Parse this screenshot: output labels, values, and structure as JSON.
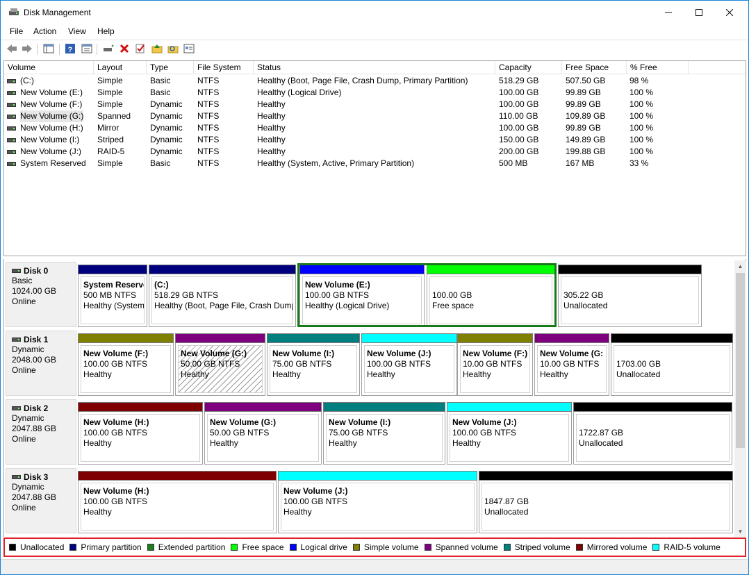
{
  "window": {
    "title": "Disk Management"
  },
  "menu": [
    "File",
    "Action",
    "View",
    "Help"
  ],
  "list": {
    "columns": [
      "Volume",
      "Layout",
      "Type",
      "File System",
      "Status",
      "Capacity",
      "Free Space",
      "% Free"
    ],
    "rows": [
      {
        "volume": "(C:)",
        "layout": "Simple",
        "type": "Basic",
        "fs": "NTFS",
        "status": "Healthy (Boot, Page File, Crash Dump, Primary Partition)",
        "capacity": "518.29 GB",
        "free": "507.50 GB",
        "pct": "98 %"
      },
      {
        "volume": "New Volume (E:)",
        "layout": "Simple",
        "type": "Basic",
        "fs": "NTFS",
        "status": "Healthy (Logical Drive)",
        "capacity": "100.00 GB",
        "free": "99.89 GB",
        "pct": "100 %"
      },
      {
        "volume": "New Volume (F:)",
        "layout": "Simple",
        "type": "Dynamic",
        "fs": "NTFS",
        "status": "Healthy",
        "capacity": "100.00 GB",
        "free": "99.89 GB",
        "pct": "100 %"
      },
      {
        "volume": "New Volume (G:)",
        "layout": "Spanned",
        "type": "Dynamic",
        "fs": "NTFS",
        "status": "Healthy",
        "capacity": "110.00 GB",
        "free": "109.89 GB",
        "pct": "100 %"
      },
      {
        "volume": "New Volume (H:)",
        "layout": "Mirror",
        "type": "Dynamic",
        "fs": "NTFS",
        "status": "Healthy",
        "capacity": "100.00 GB",
        "free": "99.89 GB",
        "pct": "100 %"
      },
      {
        "volume": "New Volume (I:)",
        "layout": "Striped",
        "type": "Dynamic",
        "fs": "NTFS",
        "status": "Healthy",
        "capacity": "150.00 GB",
        "free": "149.89 GB",
        "pct": "100 %"
      },
      {
        "volume": "New Volume (J:)",
        "layout": "RAID-5",
        "type": "Dynamic",
        "fs": "NTFS",
        "status": "Healthy",
        "capacity": "200.00 GB",
        "free": "199.88 GB",
        "pct": "100 %"
      },
      {
        "volume": "System Reserved",
        "layout": "Simple",
        "type": "Basic",
        "fs": "NTFS",
        "status": "Healthy (System, Active, Primary Partition)",
        "capacity": "500 MB",
        "free": "167 MB",
        "pct": "33 %"
      }
    ]
  },
  "colors": {
    "unallocated": "#000000",
    "primary": "#00007f",
    "extended": "#1f7f1f",
    "free": "#00ff00",
    "logical": "#0000ff",
    "simple": "#7f7f00",
    "spanned": "#7f007f",
    "striped": "#007f7f",
    "mirrored": "#7f0000",
    "raid5": "#00ffff"
  },
  "disks": [
    {
      "name": "Disk 0",
      "kind": "Basic",
      "size": "1024.00 GB",
      "state": "Online",
      "partitions": [
        {
          "title": "System Reserve",
          "size": "500 MB NTFS",
          "status": "Healthy (System",
          "color": "#00007f"
        },
        {
          "title": "(C:)",
          "size": "518.29 GB NTFS",
          "status": "Healthy (Boot, Page File, Crash Dump",
          "color": "#00007f"
        },
        {
          "title": "New Volume  (E:)",
          "size": "100.00 GB NTFS",
          "status": "Healthy (Logical Drive)",
          "color": "#0000ff"
        },
        {
          "title": "",
          "size": "100.00 GB",
          "status": "Free space",
          "color": "#00ff00"
        },
        {
          "title": "",
          "size": "305.22 GB",
          "status": "Unallocated",
          "color": "#000000"
        }
      ]
    },
    {
      "name": "Disk 1",
      "kind": "Dynamic",
      "size": "2048.00 GB",
      "state": "Online",
      "partitions": [
        {
          "title": "New Volume  (F:)",
          "size": "100.00 GB NTFS",
          "status": "Healthy",
          "color": "#7f7f00"
        },
        {
          "title": "New Volume  (G:)",
          "size": "50.00 GB NTFS",
          "status": "Healthy",
          "color": "#7f007f"
        },
        {
          "title": "New Volume  (I:)",
          "size": "75.00 GB NTFS",
          "status": "Healthy",
          "color": "#007f7f"
        },
        {
          "title": "New Volume  (J:)",
          "size": "100.00 GB NTFS",
          "status": "Healthy",
          "color": "#00ffff"
        },
        {
          "title": "New Volume  (F:)",
          "size": "10.00 GB NTFS",
          "status": "Healthy",
          "color": "#7f7f00"
        },
        {
          "title": "New Volume  (G:",
          "size": "10.00 GB NTFS",
          "status": "Healthy",
          "color": "#7f007f"
        },
        {
          "title": "",
          "size": "1703.00 GB",
          "status": "Unallocated",
          "color": "#000000"
        }
      ]
    },
    {
      "name": "Disk 2",
      "kind": "Dynamic",
      "size": "2047.88 GB",
      "state": "Online",
      "partitions": [
        {
          "title": "New Volume  (H:)",
          "size": "100.00 GB NTFS",
          "status": "Healthy",
          "color": "#7f0000"
        },
        {
          "title": "New Volume  (G:)",
          "size": "50.00 GB NTFS",
          "status": "Healthy",
          "color": "#7f007f"
        },
        {
          "title": "New Volume  (I:)",
          "size": "75.00 GB NTFS",
          "status": "Healthy",
          "color": "#007f7f"
        },
        {
          "title": "New Volume  (J:)",
          "size": "100.00 GB NTFS",
          "status": "Healthy",
          "color": "#00ffff"
        },
        {
          "title": "",
          "size": "1722.87 GB",
          "status": "Unallocated",
          "color": "#000000"
        }
      ]
    },
    {
      "name": "Disk 3",
      "kind": "Dynamic",
      "size": "2047.88 GB",
      "state": "Online",
      "partitions": [
        {
          "title": "New Volume  (H:)",
          "size": "100.00 GB NTFS",
          "status": "Healthy",
          "color": "#7f0000"
        },
        {
          "title": "New Volume  (J:)",
          "size": "100.00 GB NTFS",
          "status": "Healthy",
          "color": "#00ffff"
        },
        {
          "title": "",
          "size": "1847.87 GB",
          "status": "Unallocated",
          "color": "#000000"
        }
      ]
    }
  ],
  "legend": [
    {
      "label": "Unallocated",
      "color": "#000000"
    },
    {
      "label": "Primary partition",
      "color": "#00007f"
    },
    {
      "label": "Extended partition",
      "color": "#1f7f1f"
    },
    {
      "label": "Free space",
      "color": "#00ff00"
    },
    {
      "label": "Logical drive",
      "color": "#0000ff"
    },
    {
      "label": "Simple volume",
      "color": "#7f7f00"
    },
    {
      "label": "Spanned volume",
      "color": "#7f007f"
    },
    {
      "label": "Striped volume",
      "color": "#007f7f"
    },
    {
      "label": "Mirrored volume",
      "color": "#7f0000"
    },
    {
      "label": "RAID-5 volume",
      "color": "#00ffff"
    }
  ]
}
